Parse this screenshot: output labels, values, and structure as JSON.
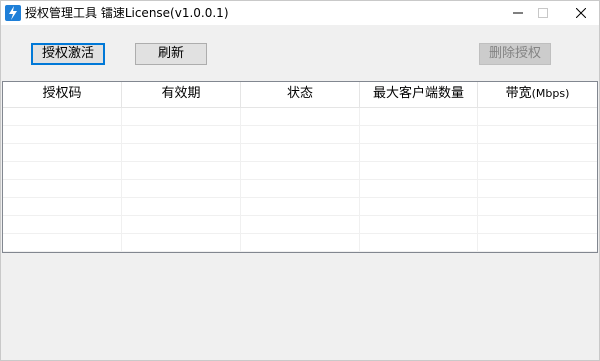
{
  "window": {
    "title": "授权管理工具 镭速License(v1.0.0.1)"
  },
  "toolbar": {
    "activate_label": "授权激活",
    "refresh_label": "刷新",
    "delete_label": "删除授权"
  },
  "table": {
    "columns": [
      "授权码",
      "有效期",
      "状态",
      "最大客户端数量",
      "带宽"
    ],
    "bandwidth_unit": "(Mbps)",
    "rows": []
  },
  "colors": {
    "icon_bg": "#1e7fd8",
    "focus_border": "#0078d7"
  },
  "icons": {
    "app": "lightning-icon",
    "minimize": "minimize-icon",
    "maximize": "maximize-icon",
    "close": "close-icon"
  }
}
